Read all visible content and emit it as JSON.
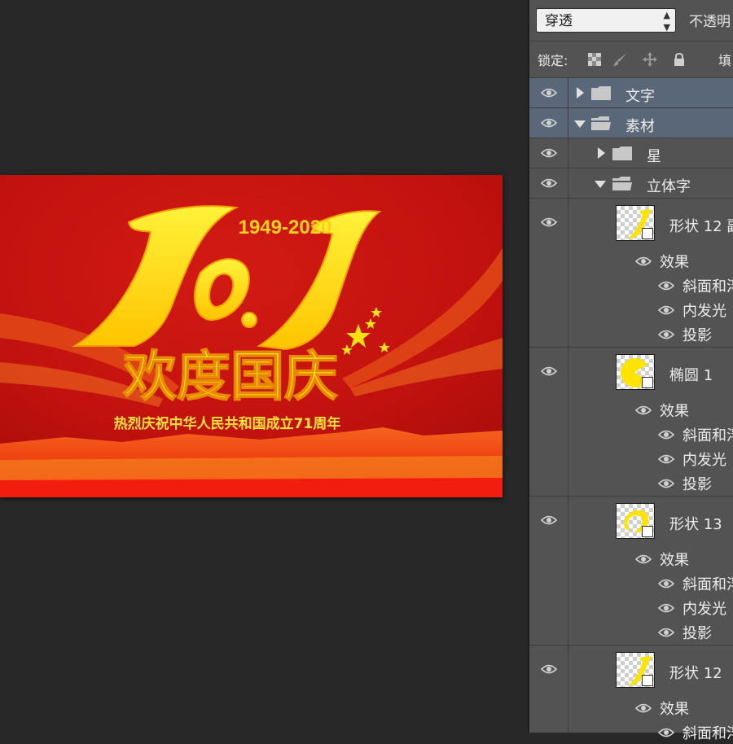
{
  "artwork": {
    "years": "1949-2020",
    "big_number": "10.1",
    "headline": "欢度国庆",
    "subline": "热烈庆祝中华人民共和国成立71周年"
  },
  "layers_panel": {
    "blend_mode": "穿透",
    "opacity_label": "不透明",
    "lock_label": "锁定:",
    "fill_label": "填",
    "groups": [
      {
        "name": "文字",
        "expanded": false,
        "selected": true
      },
      {
        "name": "素材",
        "expanded": true,
        "selected": true
      },
      {
        "name": "星",
        "expanded": false,
        "selected": false
      },
      {
        "name": "立体字",
        "expanded": true,
        "selected": false
      }
    ],
    "layers": [
      {
        "name": "形状 12 副",
        "effects_label": "效果",
        "effects": [
          "斜面和浮雕",
          "内发光",
          "投影"
        ]
      },
      {
        "name": "椭圆 1",
        "effects_label": "效果",
        "effects": [
          "斜面和浮雕",
          "内发光",
          "投影"
        ]
      },
      {
        "name": "形状 13",
        "effects_label": "效果",
        "effects": [
          "斜面和浮雕",
          "内发光",
          "投影"
        ]
      },
      {
        "name": "形状 12",
        "effects_label": "效果",
        "effects": [
          "斜面和浮雕"
        ]
      }
    ]
  },
  "colors": {
    "panel_bg": "#535353",
    "selected_row": "#596779",
    "canvas_bg": "#282828",
    "poster_red": "#c8140f",
    "poster_yellow": "#ffe010"
  }
}
